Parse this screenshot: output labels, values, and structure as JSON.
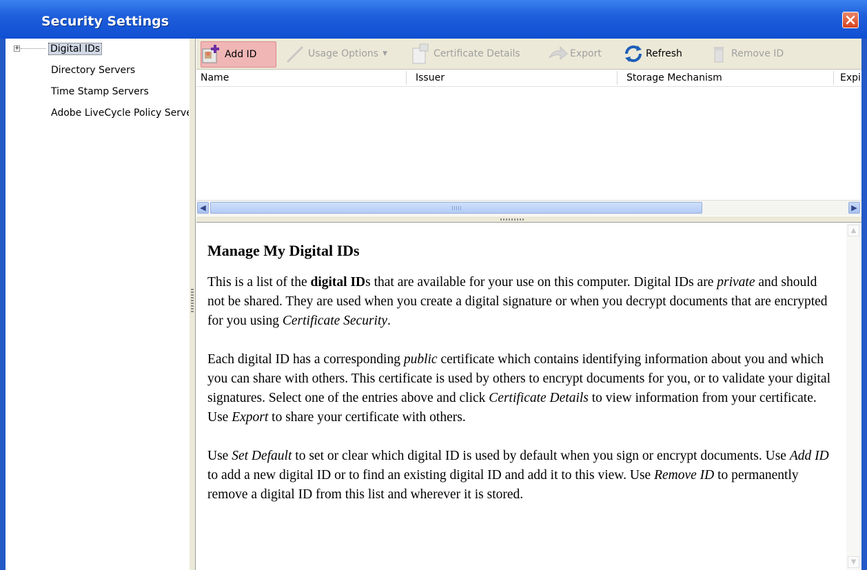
{
  "window": {
    "title": "Security Settings"
  },
  "sidebar": {
    "items": [
      {
        "label": "Digital IDs",
        "expandable": true,
        "selected": true
      },
      {
        "label": "Directory Servers"
      },
      {
        "label": "Time Stamp Servers"
      },
      {
        "label": "Adobe LiveCycle Policy Server"
      }
    ]
  },
  "toolbar": {
    "add_id": "Add ID",
    "usage_options": "Usage Options",
    "certificate_details": "Certificate Details",
    "export": "Export",
    "refresh": "Refresh",
    "remove_id": "Remove ID"
  },
  "table": {
    "columns": [
      "Name",
      "Issuer",
      "Storage Mechanism",
      "Expires"
    ],
    "rows": []
  },
  "help": {
    "heading": "Manage My Digital IDs",
    "p1": {
      "a": "This is a list of the ",
      "b": "digital ID",
      "c": "s that are available for your use on this computer. Digital IDs are ",
      "d": "private",
      "e": " and should not be shared. They are used when you create a digital signature or when you decrypt documents that are encrypted for you using ",
      "f": "Certificate Security",
      "g": "."
    },
    "p2": {
      "a": "Each digital ID has a corresponding ",
      "b": "public",
      "c": " certificate which contains identifying information about you and which you can share with others. This certificate is used by others to encrypt documents for you, or to validate your digital signatures. Select one of the entries above and click ",
      "d": "Certificate Details",
      "e": " to view information from your certificate. Use ",
      "f": "Export",
      "g": " to share your certificate with others."
    },
    "p3": {
      "a": "Use ",
      "b": "Set Default",
      "c": " to set or clear which digital ID is used by default when you sign or encrypt documents. Use ",
      "d": "Add ID",
      "e": " to add a new digital ID or to find an existing digital ID and add it to this view. Use ",
      "f": "Remove ID",
      "g": " to permanently remove a digital ID from this list and wherever it is stored."
    }
  },
  "colors": {
    "titlebar": "#0f4fd2",
    "chrome": "#ece9d8",
    "hot_button": "#f0b6b6"
  }
}
